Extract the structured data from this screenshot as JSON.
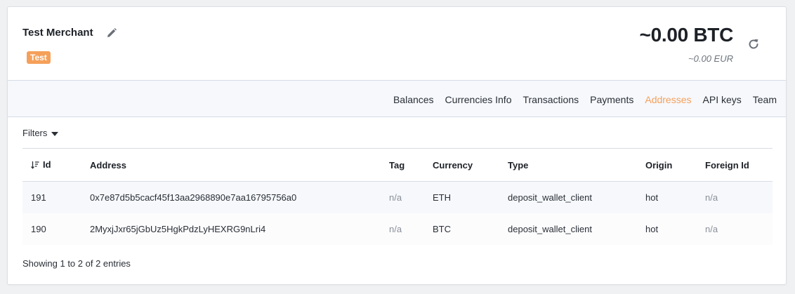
{
  "header": {
    "merchant_name": "Test Merchant",
    "badge": "Test",
    "balance_main": "~0.00 BTC",
    "balance_sub": "~0.00 EUR"
  },
  "nav": {
    "items": [
      {
        "label": "Balances",
        "active": false
      },
      {
        "label": "Currencies Info",
        "active": false
      },
      {
        "label": "Transactions",
        "active": false
      },
      {
        "label": "Payments",
        "active": false
      },
      {
        "label": "Addresses",
        "active": true
      },
      {
        "label": "API keys",
        "active": false
      },
      {
        "label": "Team",
        "active": false
      }
    ]
  },
  "filters": {
    "label": "Filters"
  },
  "table": {
    "columns": [
      "Id",
      "Address",
      "Tag",
      "Currency",
      "Type",
      "Origin",
      "Foreign Id"
    ],
    "rows": [
      {
        "id": "191",
        "address": "0x7e87d5b5cacf45f13aa2968890e7aa16795756a0",
        "tag": "n/a",
        "currency": "ETH",
        "type": "deposit_wallet_client",
        "origin": "hot",
        "foreign_id": "n/a"
      },
      {
        "id": "190",
        "address": "2MyxjJxr65jGbUz5HgkPdzLyHEXRG9nLri4",
        "tag": "n/a",
        "currency": "BTC",
        "type": "deposit_wallet_client",
        "origin": "hot",
        "foreign_id": "n/a"
      }
    ]
  },
  "footer": {
    "entries_text": "Showing 1 to 2 of 2 entries"
  },
  "colors": {
    "accent": "#f5a05a",
    "nav_bg": "#f6f8fc",
    "row_alt": "#f6f8fc"
  },
  "icons": [
    "pencil-icon",
    "refresh-icon",
    "sort-descending-icon",
    "caret-down-icon"
  ]
}
